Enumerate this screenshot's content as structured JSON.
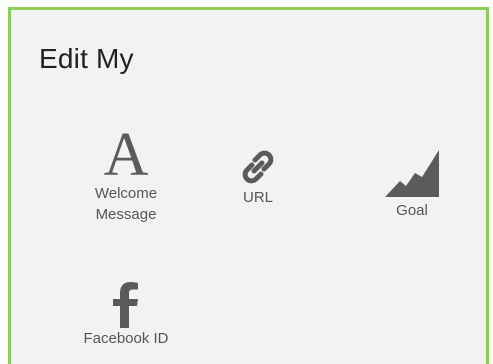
{
  "panel": {
    "title": "Edit My",
    "accent_border": "#8bcd55",
    "icon_color": "#5b5b5b"
  },
  "tiles": [
    {
      "key": "welcome",
      "icon": "serif-letter-a-icon",
      "glyph": "A",
      "label_line1": "Welcome",
      "label_line2": "Message"
    },
    {
      "key": "url",
      "icon": "link-icon",
      "label": "URL"
    },
    {
      "key": "goal",
      "icon": "mountain-chart-icon",
      "label": "Goal"
    },
    {
      "key": "facebook",
      "icon": "facebook-f-icon",
      "label": "Facebook ID"
    }
  ]
}
